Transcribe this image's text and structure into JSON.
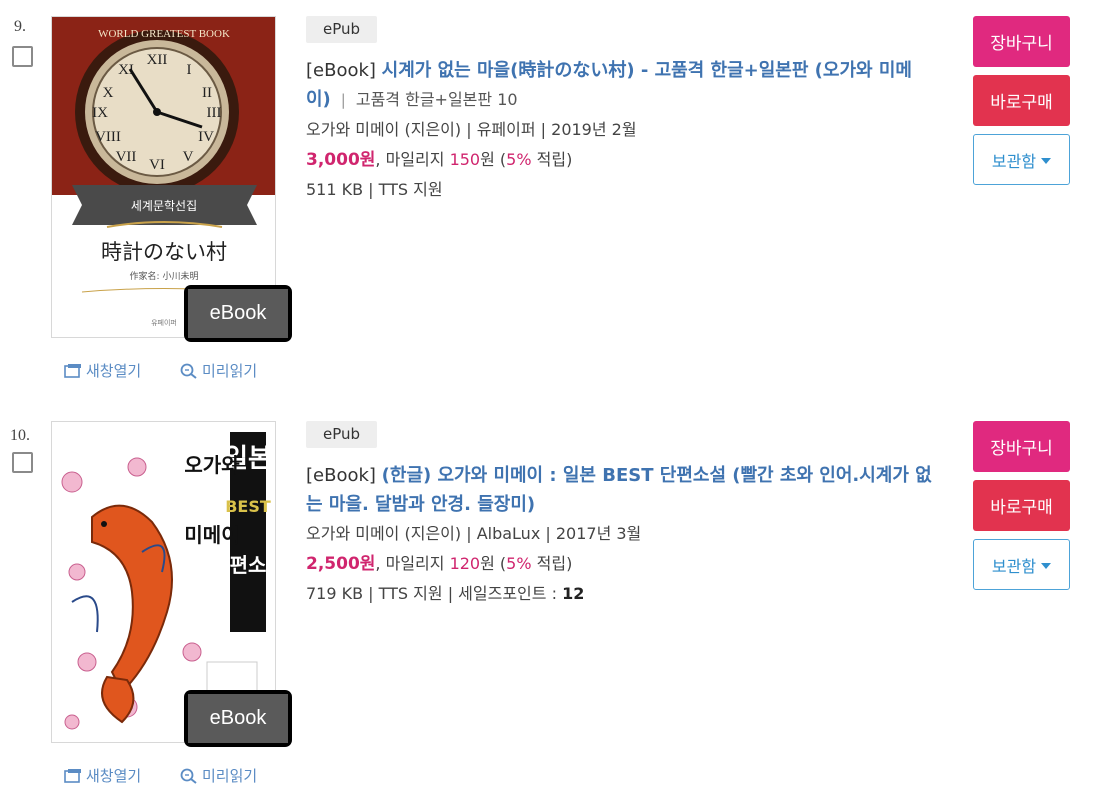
{
  "items": [
    {
      "rank": "9.",
      "format": "ePub",
      "title_prefix": "[eBook]",
      "title_main": "시계가 없는 마을(時計のない村) - 고품격 한글+일본판 (오가와 미메이)",
      "title_sep": "|",
      "title_sub": "고품격 한글+일본판 10",
      "author_pub": "오가와 미메이 (지은이) | 유페이퍼 | 2019년 2월",
      "price": "3,000원",
      "mileage_label": ", 마일리지 ",
      "mileage_value": "150",
      "mileage_unit": "원 (",
      "mileage_rate": "5%",
      "mileage_end": " 적립)",
      "size_line": "511 KB | TTS 지원",
      "sales_label": "",
      "sales_value": "",
      "cover": {
        "badge": "eBook",
        "top_text": "WORLD GREATEST BOOK",
        "series_text": "세계문학선집",
        "jp_title": "時計のない村",
        "author_text": "作家名: 小川未明",
        "publisher_text": "유페이퍼"
      }
    },
    {
      "rank": "10.",
      "format": "ePub",
      "title_prefix": "[eBook]",
      "title_main": "(한글) 오가와 미메이 : 일본 BEST 단편소설 (빨간 초와 인어.시계가 없는 마을. 달밤과 안경. 들장미)",
      "title_sep": "",
      "title_sub": "",
      "author_pub": "오가와 미메이 (지은이) | AlbaLux | 2017년 3월",
      "price": "2,500원",
      "mileage_label": ", 마일리지 ",
      "mileage_value": "120",
      "mileage_unit": "원 (",
      "mileage_rate": "5%",
      "mileage_end": " 적립)",
      "size_line": "719 KB | TTS 지원 | 세일즈포인트 : ",
      "sales_value": "12",
      "cover": {
        "badge": "eBook",
        "v1": "일본",
        "v2": "BEST",
        "v3": "단편소설",
        "v4": "오가와",
        "v5": "미메이"
      }
    }
  ],
  "links": {
    "new_window": "새창열기",
    "preview": "미리읽기"
  },
  "buttons": {
    "cart": "장바구니",
    "buy": "바로구매",
    "keep": "보관함"
  },
  "colors": {
    "title_blue": "#3f73b0",
    "price_pink": "#d0256e",
    "cart": "#e0297f",
    "buy": "#e2334f",
    "keep_border": "#4da3d8"
  },
  "icons": {
    "new_window": "new-window-icon",
    "preview": "magnifier-icon",
    "keep_caret": "caret-down-icon"
  }
}
